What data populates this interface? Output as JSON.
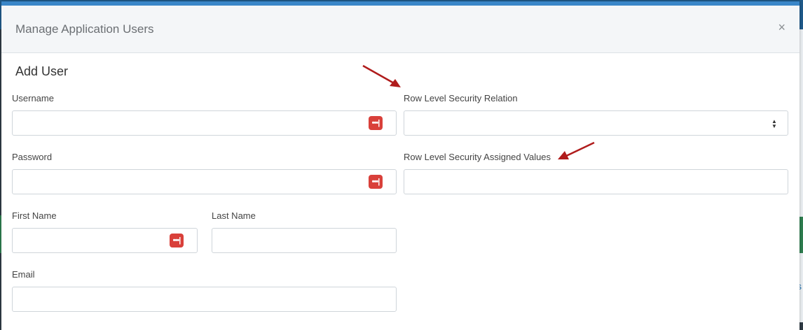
{
  "modal": {
    "title": "Manage Application Users",
    "close_label": "×",
    "section_title": "Add User"
  },
  "form": {
    "username": {
      "label": "Username",
      "value": ""
    },
    "password": {
      "label": "Password",
      "value": ""
    },
    "first_name": {
      "label": "First Name",
      "value": ""
    },
    "last_name": {
      "label": "Last Name",
      "value": ""
    },
    "email": {
      "label": "Email",
      "value": ""
    },
    "rls_relation": {
      "label": "Row Level Security Relation",
      "selected": ""
    },
    "rls_values": {
      "label": "Row Level Security Assigned Values",
      "value": ""
    }
  },
  "icons": {
    "password_manager": "password-manager-icon",
    "select_arrows": "select-arrows-icon",
    "annotation_arrow": "annotation-arrow"
  },
  "colors": {
    "accent": "#3a86c8",
    "password_badge": "#d9403a",
    "annotation_arrow": "#b01c1c"
  }
}
